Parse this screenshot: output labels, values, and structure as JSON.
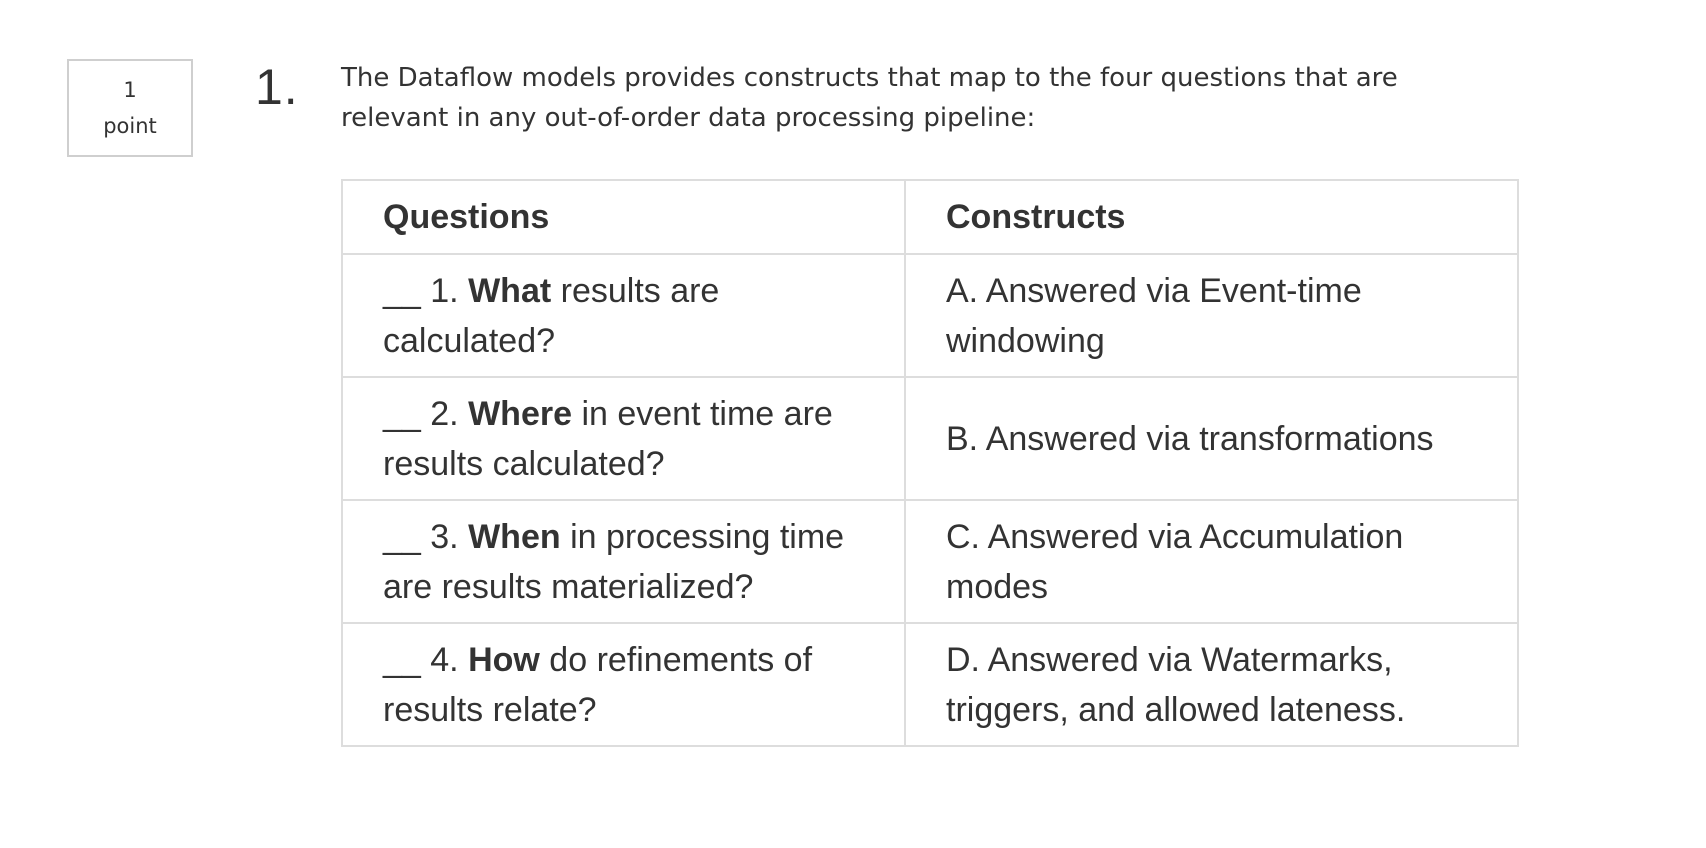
{
  "points": {
    "value": "1",
    "unit": "point"
  },
  "question": {
    "number": "1.",
    "prompt": "The Dataflow models provides constructs that map to the four questions that are relevant in any out-of-order data processing pipeline:"
  },
  "table": {
    "headers": [
      "Questions",
      "Constructs"
    ],
    "rows": [
      {
        "blank": "__ 1. ",
        "keyword": "What",
        "question_rest": " results are calculated?",
        "construct": "A. Answered via Event-time windowing"
      },
      {
        "blank": "__ 2. ",
        "keyword": "Where",
        "question_rest": " in event time are results calculated?",
        "construct": "B. Answered via transformations"
      },
      {
        "blank": "__ 3. ",
        "keyword": "When",
        "question_rest": " in processing time are results materialized?",
        "construct": "C. Answered via Accumulation modes"
      },
      {
        "blank": "__ 4. ",
        "keyword": "How",
        "question_rest": " do refinements of results relate?",
        "construct": "D. Answered via Watermarks, triggers, and allowed lateness."
      }
    ]
  }
}
